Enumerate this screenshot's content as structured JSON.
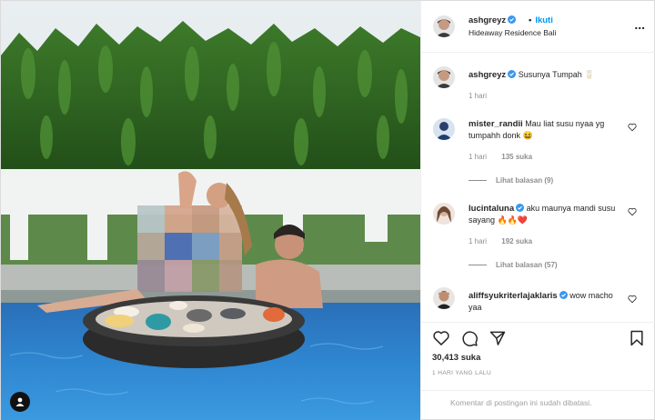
{
  "post": {
    "username": "ashgreyz",
    "follow_label": "Ikuti",
    "separator": "•",
    "location": "Hideaway Residence Bali",
    "more_label": "..."
  },
  "caption": {
    "username": "ashgreyz",
    "text": "Susunya Tumpah 🥛",
    "time": "1 hari"
  },
  "comments": [
    {
      "username": "mister_randii",
      "text": "Mau liat susu nyaa yg tumpahh donk 😆",
      "time": "1 hari",
      "likes": "135 suka",
      "replies": "Lihat balasan (9)",
      "verified": false
    },
    {
      "username": "lucintaluna",
      "text": "aku maunya mandi susu sayang 🔥🔥❤️",
      "time": "1 hari",
      "likes": "192 suka",
      "replies": "Lihat balasan (57)",
      "verified": true
    },
    {
      "username": "aliffsyukriterlajaklaris",
      "text": "wow macho yaa",
      "verified": true
    }
  ],
  "likes_count": "30,413 suka",
  "post_date": "1 HARI YANG LALU",
  "comments_closed": "Komentar di postingan ini sudah dibatasi.",
  "icons": {
    "like": "heart-icon",
    "comment": "comment-bubble-icon",
    "share": "paper-plane-icon",
    "save": "bookmark-icon",
    "verified": "verified-badge-icon",
    "tag": "user-tag-icon"
  },
  "colors": {
    "accent": "#0095f6",
    "muted": "#8e8e8e",
    "text": "#262626",
    "verified": "#3897f0"
  }
}
